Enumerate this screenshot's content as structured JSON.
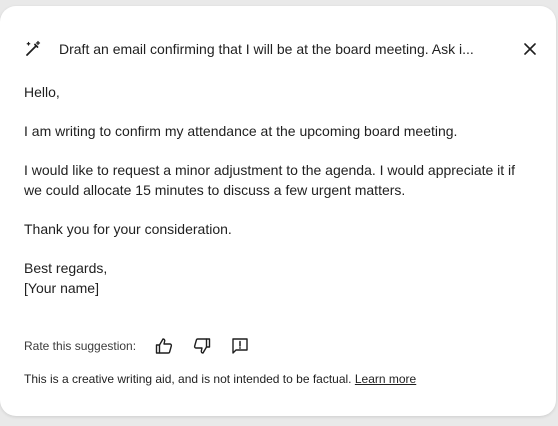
{
  "header": {
    "prompt": "Draft an email confirming that I will be at the board meeting. Ask i...",
    "pen_icon": "pen-sparkle-icon",
    "close_icon": "close-icon"
  },
  "email": {
    "greeting": "Hello,",
    "p1": "I am writing to confirm my attendance at the upcoming board meeting.",
    "p2": "I would like to request a minor adjustment to the agenda. I would appreciate it if we could allocate 15 minutes to discuss a few urgent matters.",
    "p3": "Thank you for your consideration.",
    "closing": "Best regards,",
    "name": "[Your name]"
  },
  "feedback": {
    "label": "Rate this suggestion:",
    "icons": [
      "thumbs-up-icon",
      "thumbs-down-icon",
      "report-icon"
    ]
  },
  "footer": {
    "disclaimer": "This is a creative writing aid, and is not intended to be factual.",
    "learn_more": "Learn more"
  },
  "colors": {
    "background": "#e9e9e9",
    "card": "#ffffff",
    "text": "#1f1f1f"
  }
}
